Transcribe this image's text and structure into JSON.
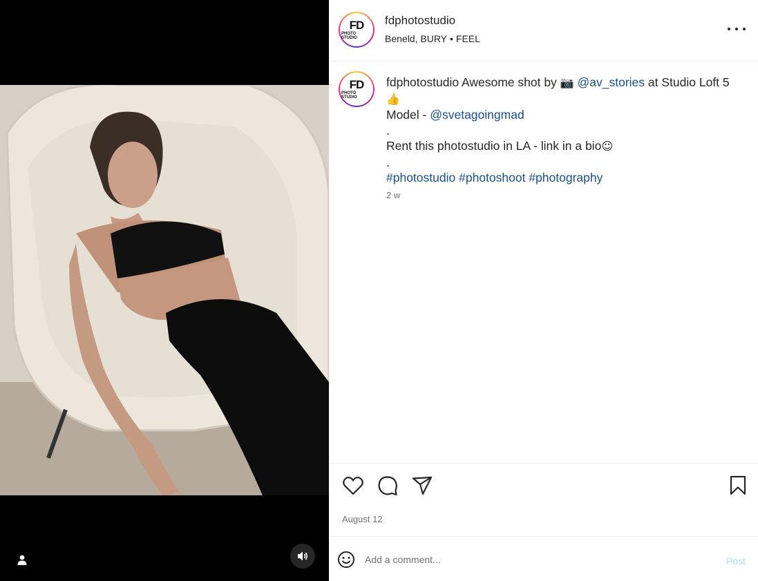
{
  "post": {
    "username": "fdphotostudio",
    "location_place": "Beneld, BURY",
    "location_separator": "•",
    "location_extra": "FEEL",
    "avatar_text_main": "FD",
    "avatar_text_sub": "PHOTO STUDIO"
  },
  "caption": {
    "username": "fdphotostudio",
    "text_1": "Awesome shot by",
    "camera_emoji": "📷",
    "mention_1": "@av_stories",
    "text_2": "at Studio Loft 5",
    "thumbs_emoji": "👍",
    "model_label": "Model - ",
    "mention_2": "@svetagoingmad",
    "dot_1": ".",
    "line_rent": "Rent this photostudio in LA - link in a bio",
    "smile_emoji": "☺",
    "dot_2": ".",
    "hashtag_1": "#photostudio",
    "hashtag_2": "#photoshoot",
    "hashtag_3": "#photography",
    "time_ago": "2 w"
  },
  "actions": {
    "icons": [
      "heart-icon",
      "comment-icon",
      "share-icon",
      "bookmark-icon"
    ],
    "date": "August 12"
  },
  "comment": {
    "placeholder": "Add a comment...",
    "post_label": "Post"
  },
  "colors": {
    "link": "#1a4f8a",
    "post_disabled": "#b2dffc",
    "secondary_text": "#737373"
  }
}
